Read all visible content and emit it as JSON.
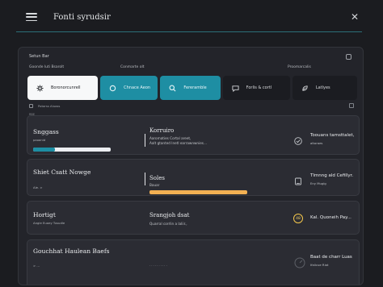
{
  "window": {
    "title": "Fonti syrudsir"
  },
  "panel": {
    "header": "Setun Bar",
    "seg_labels": [
      "Goonde luti Bsarolt",
      "Conmarte olt",
      "Proomarcalis"
    ],
    "segments": [
      {
        "label": "Boronorcunrell",
        "icon": "gear-icon"
      },
      {
        "label": "Chnace Aeon",
        "icon": "circle-icon"
      },
      {
        "label": "Fereramble",
        "icon": "search-icon"
      },
      {
        "label": "Forlis & cortl",
        "icon": "chat-icon"
      },
      {
        "label": "Latlyes",
        "icon": "leaf-icon"
      }
    ],
    "sub_row": "Potorss Aluoss",
    "section_tag_1": "RBE",
    "section_tag_2": "TEB"
  },
  "cards": [
    {
      "title": "Snggass",
      "subtitle": "paoanid",
      "mid_title": "Korruiro",
      "mid_lines": [
        "Aaromaties Cortal areet,",
        "Aalt gtanted lnetl earrawnwnies..."
      ],
      "right_title": "Toouans tamsttalet,",
      "right_sub": "altoraes",
      "progress": 0.28,
      "progress_color": "#1d8ea3",
      "right_icon": "check-circle-icon"
    },
    {
      "title": "Shiet Csatt Nowge",
      "subtitle": "Ale. >",
      "mid_title": "Soles",
      "mid_lines": [
        "Bauar"
      ],
      "right_title": "Tlmnng ald Cefillyr.",
      "right_sub": "Eny Muglg",
      "progress": 1.0,
      "progress_color": "#f2b052",
      "right_icon": "tablet-icon"
    },
    {
      "title": "Hortigt",
      "subtitle": "Angie Euoey   Tusudle",
      "mid_title": "Srangjoh dsat",
      "mid_lines": [
        "Quarral corrlin a laliir.,"
      ],
      "right_title": "Kal. Quoneih Pay...",
      "right_sub": "",
      "badge": "48",
      "right_icon": "badge-icon"
    },
    {
      "title": "Gouchhat Haulean Baefs",
      "subtitle": "> ...",
      "mid_title": "",
      "mid_lines": [
        ""
      ],
      "right_title": "Baat de charr Luas",
      "right_sub": "Ifalicue Riat",
      "right_icon": "dial-icon"
    }
  ],
  "colors": {
    "accent": "#1d8ea3",
    "orange": "#f2b052",
    "badge": "#f4c74b"
  }
}
